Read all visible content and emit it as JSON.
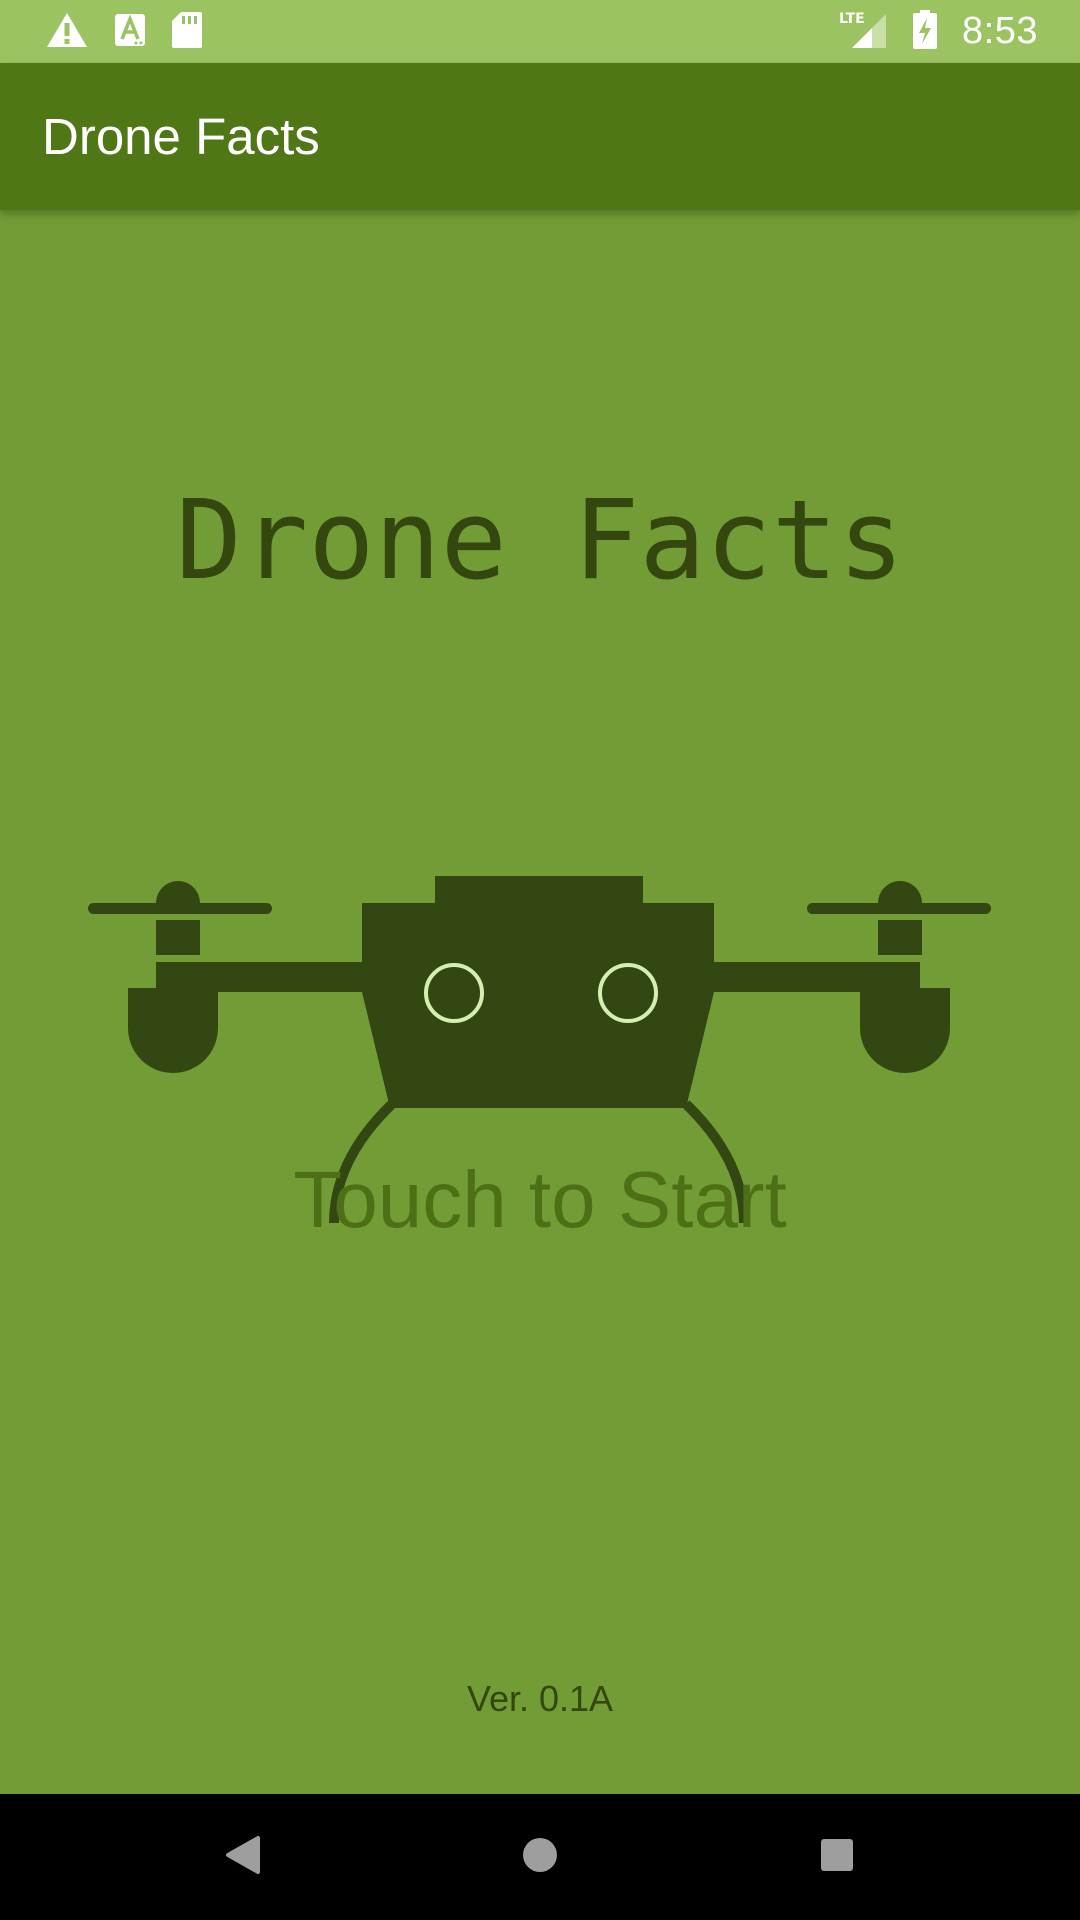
{
  "status_bar": {
    "time": "8:53",
    "icons_left": [
      "warning-icon",
      "text-a-icon",
      "sd-card-icon"
    ],
    "network_label": "LTE",
    "icons_right": [
      "lte-signal-icon",
      "battery-charging-icon"
    ]
  },
  "app_bar": {
    "title": "Drone Facts"
  },
  "splash": {
    "title": "Drone Facts",
    "logo": "drone-icon",
    "start_label": "Touch to Start",
    "version": "Ver. 0.1A"
  },
  "nav_bar": {
    "buttons": [
      "back-icon",
      "home-icon",
      "recents-icon"
    ]
  },
  "colors": {
    "status_bar": "#9cc361",
    "app_bar": "#4f7716",
    "background": "#729c35",
    "drone": "#334712",
    "accent_light": "#d6efb0",
    "start_text": "#4d7016"
  }
}
